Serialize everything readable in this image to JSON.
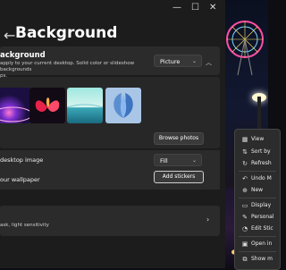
{
  "window": {
    "back_icon": "back-arrow-icon",
    "title": "Background",
    "controls": [
      "minimize-icon",
      "maximize-icon",
      "close-icon"
    ]
  },
  "personalize_bg": {
    "title": "ackground",
    "desc_line1": "apply to your current desktop. Solid color or slideshow backgrounds",
    "desc_line2": "ps.",
    "type_value": "Picture"
  },
  "recent_images": [
    {
      "name": "purple-swirl"
    },
    {
      "name": "red-flower"
    },
    {
      "name": "teal-lake"
    },
    {
      "name": "blue-bloom"
    }
  ],
  "browse_label": "Browse photos",
  "fit": {
    "label": "desktop image",
    "value": "Fill"
  },
  "stickers": {
    "label": "our wallpaper",
    "button": "Add stickers"
  },
  "related": {
    "desc": "ask, light sensitivity"
  },
  "context_menu": [
    {
      "label": "View",
      "icon": "view-icon"
    },
    {
      "label": "Sort by",
      "icon": "sort-icon"
    },
    {
      "label": "Refresh",
      "icon": "refresh-icon"
    },
    {
      "label": "Undo M",
      "icon": "undo-icon"
    },
    {
      "label": "New",
      "icon": "new-icon"
    },
    {
      "label": "Display",
      "icon": "display-icon"
    },
    {
      "label": "Personal",
      "icon": "personalize-icon"
    },
    {
      "label": "Edit Stic",
      "icon": "sticker-icon"
    },
    {
      "label": "Open in",
      "icon": "terminal-icon"
    },
    {
      "label": "Show m",
      "icon": "more-icon"
    }
  ]
}
